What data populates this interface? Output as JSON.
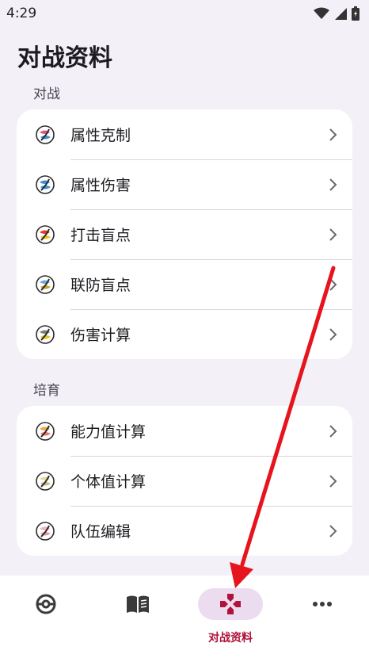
{
  "status_bar": {
    "time": "4:29",
    "icons": [
      "wifi-icon",
      "signal-icon",
      "battery-icon"
    ]
  },
  "page": {
    "title": "对战资料"
  },
  "sections": [
    {
      "label": "对战",
      "items": [
        {
          "label": "属性克制",
          "icon": "type-chart-ball-icon",
          "icon_colors": [
            "#e05a7a",
            "#3f8fd6",
            "#2a2a2a"
          ]
        },
        {
          "label": "属性伤害",
          "icon": "type-damage-ball-icon",
          "icon_colors": [
            "#3f8fd6",
            "#3f8fd6",
            "#2a2a2a"
          ]
        },
        {
          "label": "打击盲点",
          "icon": "coverage-ball-icon",
          "icon_colors": [
            "#e8392e",
            "#f2c21b",
            "#2a2a2a"
          ]
        },
        {
          "label": "联防盲点",
          "icon": "defense-ball-icon",
          "icon_colors": [
            "#6fa7e0",
            "#c9a62a",
            "#2a2a2a"
          ]
        },
        {
          "label": "伤害计算",
          "icon": "damage-calc-ball-icon",
          "icon_colors": [
            "#7e7e7e",
            "#e6c51f",
            "#2a2a2a"
          ]
        }
      ]
    },
    {
      "label": "培育",
      "items": [
        {
          "label": "能力值计算",
          "icon": "stats-calc-ball-icon",
          "icon_colors": [
            "#f0a64a",
            "#e8766a",
            "#2a2a2a"
          ]
        },
        {
          "label": "个体值计算",
          "icon": "iv-calc-ball-icon",
          "icon_colors": [
            "#e4dca0",
            "#c9b87a",
            "#2a2a2a"
          ]
        },
        {
          "label": "队伍编辑",
          "icon": "team-edit-ball-icon",
          "icon_colors": [
            "#f2b4be",
            "#e79aa6",
            "#2a2a2a"
          ]
        }
      ]
    }
  ],
  "bottom_nav": {
    "items": [
      {
        "name": "pokeball-icon",
        "label": "",
        "active": false
      },
      {
        "name": "book-icon",
        "label": "",
        "active": false
      },
      {
        "name": "gamepad-icon",
        "label": "对战资料",
        "active": true
      },
      {
        "name": "more-icon",
        "label": "",
        "active": false
      }
    ],
    "active_color": "#b0123a",
    "active_pill_color": "#ecdcf0"
  },
  "annotation_arrow_color": "#e6141c"
}
